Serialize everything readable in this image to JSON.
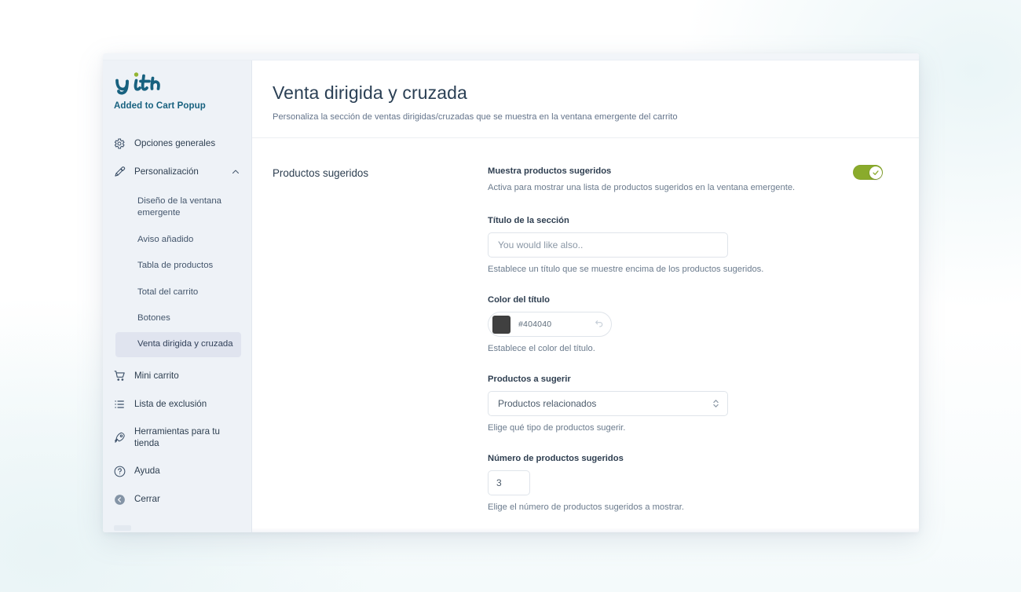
{
  "sidebar": {
    "brand": {
      "logo_text": "yith",
      "plugin_name": "Added to Cart Popup"
    },
    "items": [
      {
        "label": "Opciones generales",
        "icon": "gear-icon",
        "type": "item"
      },
      {
        "label": "Personalización",
        "icon": "eyedropper-icon",
        "type": "expandable",
        "expanded": true
      },
      {
        "label": "Mini carrito",
        "icon": "cart-icon",
        "type": "item"
      },
      {
        "label": "Lista de exclusión",
        "icon": "list-icon",
        "type": "item"
      },
      {
        "label": "Herramientas para tu tienda",
        "icon": "rocket-icon",
        "type": "item"
      },
      {
        "label": "Ayuda",
        "icon": "question-circle-icon",
        "type": "item"
      },
      {
        "label": "Cerrar",
        "icon": "back-circle-icon",
        "type": "item"
      }
    ],
    "subitems": [
      {
        "label": "Diseño de la ventana emergente",
        "active": false
      },
      {
        "label": "Aviso añadido",
        "active": false
      },
      {
        "label": "Tabla de productos",
        "active": false
      },
      {
        "label": "Total del carrito",
        "active": false
      },
      {
        "label": "Botones",
        "active": false
      },
      {
        "label": "Venta dirigida y cruzada",
        "active": true
      }
    ]
  },
  "header": {
    "title": "Venta dirigida y cruzada",
    "subtitle": "Personaliza la sección de ventas dirigidas/cruzadas que se muestra en la ventana emergente del carrito"
  },
  "panel": {
    "section_title": "Productos sugeridos",
    "fields": {
      "show_suggested": {
        "label": "Muestra productos sugeridos",
        "help": "Activa para mostrar una lista de productos sugeridos en la ventana emergente.",
        "toggle_state": "on"
      },
      "section_title_field": {
        "label": "Título de la sección",
        "value": "You would like also..",
        "placeholder": "You would like also..",
        "help": "Establece un título que se muestre encima de los productos sugeridos."
      },
      "title_color": {
        "label": "Color del título",
        "value": "#404040",
        "swatch_color": "#404040",
        "help": "Establece el color del título.",
        "reset_icon": "undo-arrow-icon"
      },
      "products_to_suggest": {
        "label": "Productos a sugerir",
        "value": "Productos relacionados",
        "options": [
          "Productos relacionados"
        ],
        "help": "Elige qué tipo de productos sugerir."
      },
      "number_of_products": {
        "label": "Número de productos sugeridos",
        "value": "3",
        "help": "Elige el número de productos sugeridos a mostrar."
      }
    }
  },
  "colors": {
    "brand_blue": "#17617f",
    "toggle_on": "#8aab2c",
    "sidebar_bg": "#eef2f7",
    "active_item_bg": "#e0e4ef",
    "title_color_value": "#404040"
  }
}
